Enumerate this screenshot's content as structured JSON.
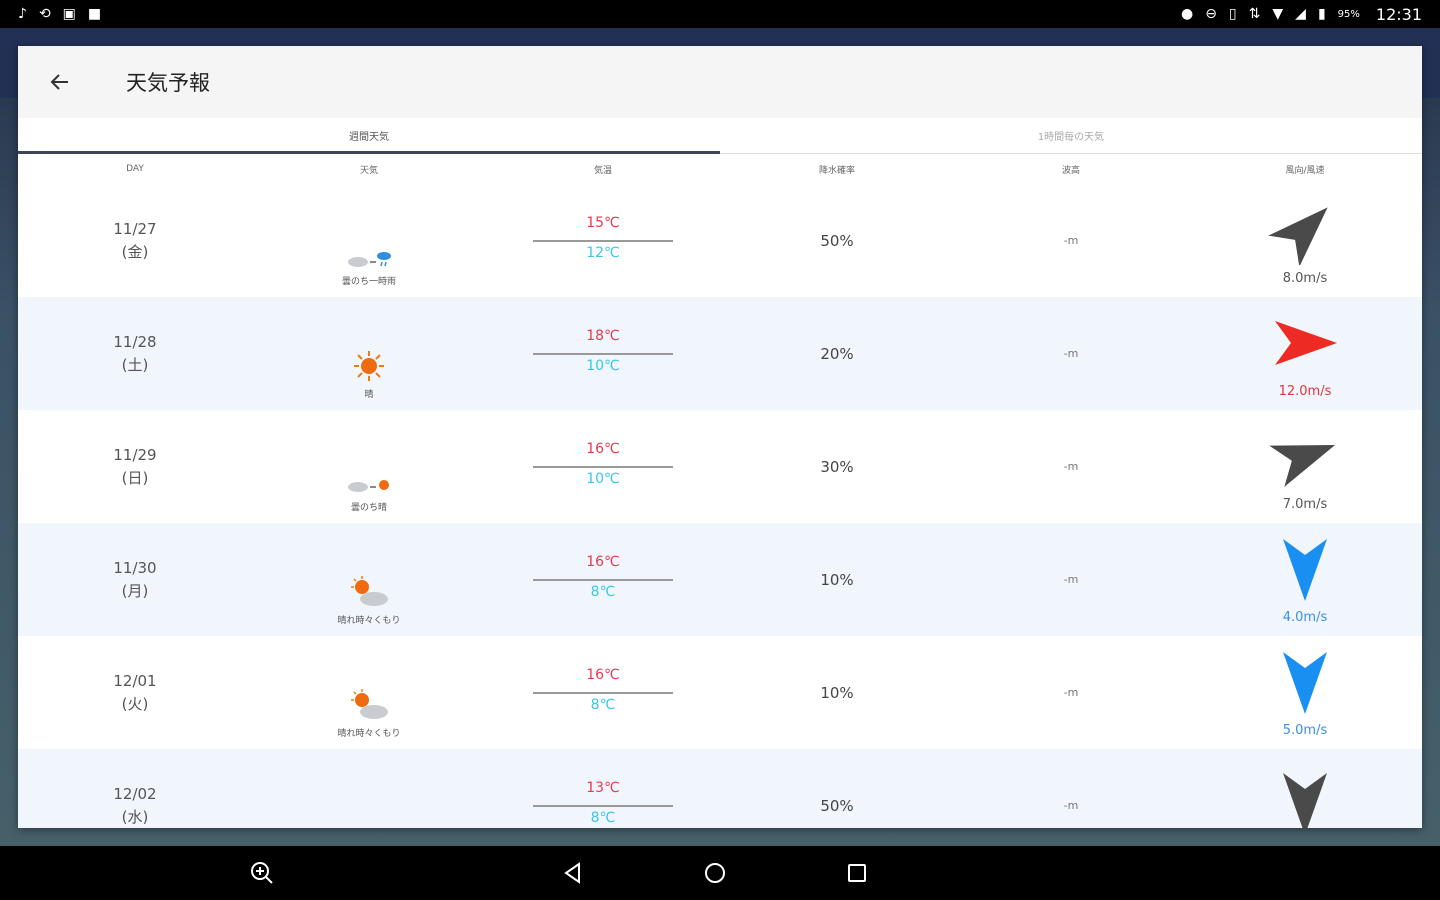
{
  "status_bar": {
    "left_icons": [
      "music-icon",
      "sync-icon",
      "image-icon",
      "app-icon"
    ],
    "right_icons": [
      "location-icon",
      "dnd-icon",
      "vibrate-icon",
      "data-icon",
      "wifi-icon",
      "signal-icon",
      "battery-icon"
    ],
    "battery": "95%",
    "time": "12:31"
  },
  "app": {
    "title": "天気予報"
  },
  "tabs": [
    {
      "label": "週間天気",
      "active": true
    },
    {
      "label": "1時間毎の天気",
      "active": false
    }
  ],
  "columns": [
    "DAY",
    "天気",
    "気温",
    "降水確率",
    "波高",
    "風向/風速"
  ],
  "rows": [
    {
      "date": "11/27",
      "dow": "(金)",
      "weather_icon": "cloud-then-rain-icon",
      "weather": "曇のち一時雨",
      "hi": "15℃",
      "lo": "12℃",
      "rain": "50%",
      "wave": "-m",
      "wind_dir": "northeast",
      "wind_color": "#4a4a4a",
      "wind": "8.0m/s",
      "wind_text_color": "#555555"
    },
    {
      "date": "11/28",
      "dow": "(土)",
      "weather_icon": "sun-icon",
      "weather": "晴",
      "hi": "18℃",
      "lo": "10℃",
      "rain": "20%",
      "wave": "-m",
      "wind_dir": "east",
      "wind_color": "#ee2a24",
      "wind": "12.0m/s",
      "wind_text_color": "#e8323a"
    },
    {
      "date": "11/29",
      "dow": "(日)",
      "weather_icon": "cloud-then-sun-icon",
      "weather": "曇のち晴",
      "hi": "16℃",
      "lo": "10℃",
      "rain": "30%",
      "wave": "-m",
      "wind_dir": "east-northeast",
      "wind_color": "#4a4a4a",
      "wind": "7.0m/s",
      "wind_text_color": "#555555"
    },
    {
      "date": "11/30",
      "dow": "(月)",
      "weather_icon": "sun-cloud-icon",
      "weather": "晴れ時々くもり",
      "hi": "16℃",
      "lo": "8℃",
      "rain": "10%",
      "wave": "-m",
      "wind_dir": "south",
      "wind_color": "#1a8ff2",
      "wind": "4.0m/s",
      "wind_text_color": "#3a8fe8"
    },
    {
      "date": "12/01",
      "dow": "(火)",
      "weather_icon": "sun-cloud-icon",
      "weather": "晴れ時々くもり",
      "hi": "16℃",
      "lo": "8℃",
      "rain": "10%",
      "wave": "-m",
      "wind_dir": "south",
      "wind_color": "#1a8ff2",
      "wind": "5.0m/s",
      "wind_text_color": "#3a8fe8"
    },
    {
      "date": "12/02",
      "dow": "(水)",
      "weather_icon": "cloud-rain-icon",
      "weather": "",
      "hi": "13℃",
      "lo": "8℃",
      "rain": "50%",
      "wave": "-m",
      "wind_dir": "south",
      "wind_color": "#4a4a4a",
      "wind": "",
      "wind_text_color": "#555555"
    }
  ],
  "nav": [
    "zoom-icon",
    "back-triangle-icon",
    "home-circle-icon",
    "recents-square-icon"
  ]
}
